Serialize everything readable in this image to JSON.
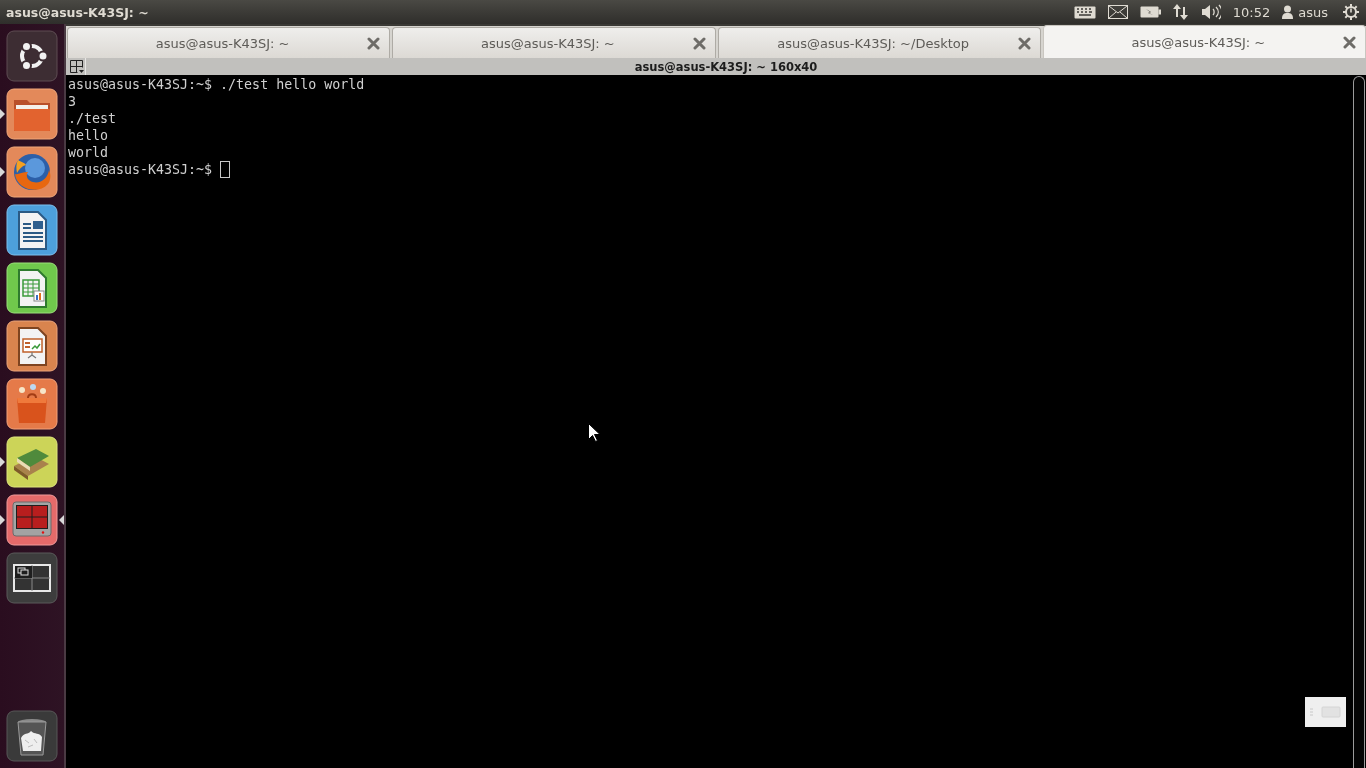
{
  "top_panel": {
    "window_title": "asus@asus-K43SJ: ~",
    "clock": "10:52",
    "user_name": "asus"
  },
  "launcher": {
    "items": [
      {
        "kind": "dash",
        "running": false,
        "focused": false
      },
      {
        "kind": "files",
        "running": true,
        "focused": false
      },
      {
        "kind": "firefox",
        "running": true,
        "focused": false
      },
      {
        "kind": "writer",
        "running": false,
        "focused": false
      },
      {
        "kind": "calc",
        "running": false,
        "focused": false
      },
      {
        "kind": "impress",
        "running": false,
        "focused": false
      },
      {
        "kind": "software",
        "running": false,
        "focused": false
      },
      {
        "kind": "books",
        "running": true,
        "focused": false
      },
      {
        "kind": "terminal",
        "running": true,
        "focused": true
      },
      {
        "kind": "workspaces",
        "running": false,
        "focused": false
      },
      {
        "kind": "trash",
        "running": false,
        "focused": false
      }
    ]
  },
  "tabs": [
    {
      "title": "asus@asus-K43SJ: ~",
      "selected": false
    },
    {
      "title": "asus@asus-K43SJ: ~",
      "selected": false
    },
    {
      "title": "asus@asus-K43SJ: ~/Desktop",
      "selected": false
    },
    {
      "title": "asus@asus-K43SJ: ~",
      "selected": true
    }
  ],
  "terminal": {
    "title": "asus@asus-K43SJ: ~ 160x40",
    "lines": [
      "asus@asus-K43SJ:~$ ./test hello world",
      "3",
      "./test",
      "hello",
      "world"
    ],
    "prompt": "asus@asus-K43SJ:~$"
  }
}
